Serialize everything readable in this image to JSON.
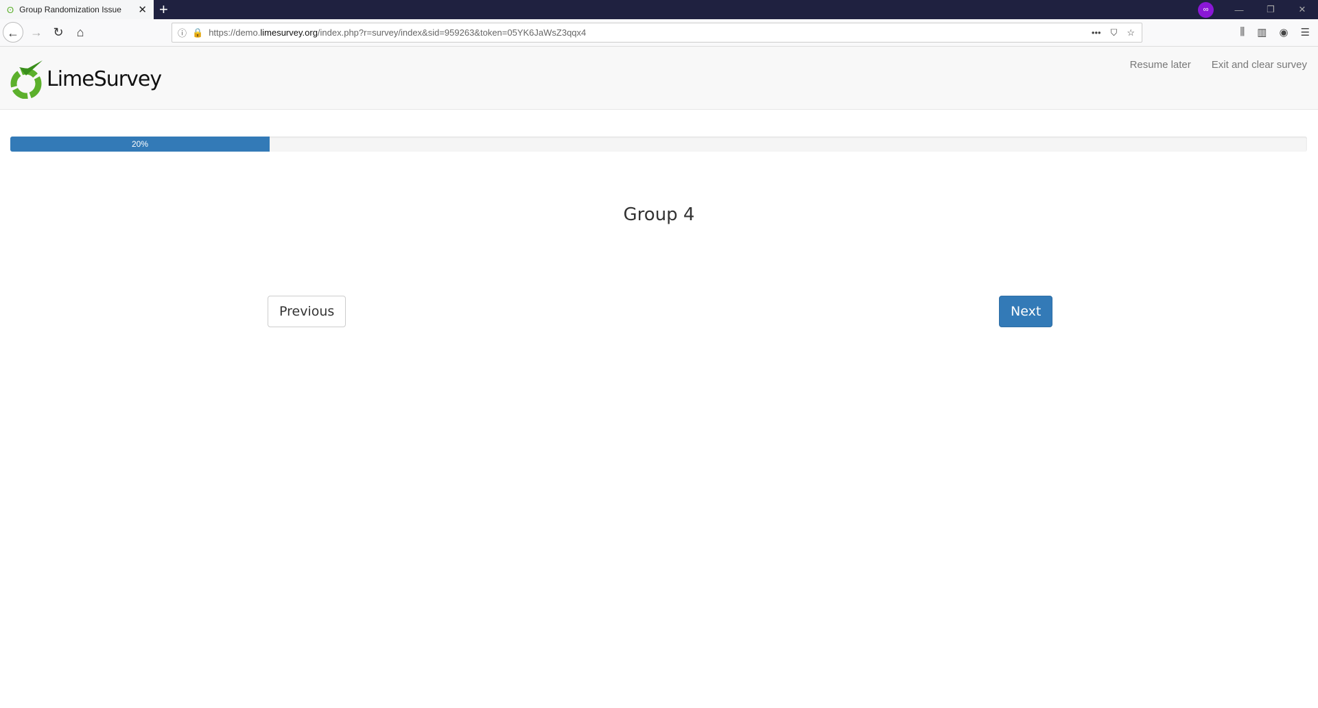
{
  "browser": {
    "tab_title": "Group Randomization Issue",
    "url_prefix": "https://demo.",
    "url_domain": "limesurvey.org",
    "url_path": "/index.php?r=survey/index&sid=959263&token=05YK6JaWsZ3qqx4"
  },
  "header": {
    "logo_text": "LimeSurvey",
    "resume_later": "Resume later",
    "exit_clear": "Exit and clear survey"
  },
  "progress": {
    "value": 20,
    "label": "20%"
  },
  "main": {
    "group_title": "Group 4",
    "previous": "Previous",
    "next": "Next"
  },
  "colors": {
    "primary": "#337ab7",
    "lime": "#5cb02c"
  }
}
